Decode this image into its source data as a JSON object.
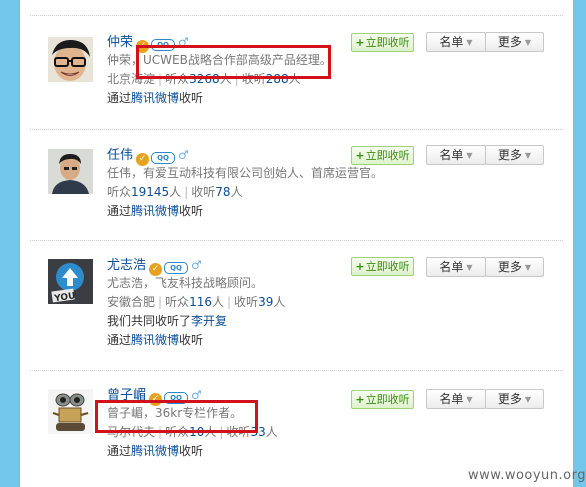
{
  "buttons": {
    "follow": "立即收听",
    "list": "名单",
    "more": "更多"
  },
  "icons": {
    "verified": "verified-badge-icon",
    "qq": "qq-icon",
    "gender": "male-icon"
  },
  "users": [
    {
      "name": "仲荣",
      "bio": "仲荣，UCWEB战略合作部高级产品经理。",
      "location": "北京海淀",
      "listeners_label": "听众",
      "listeners": "3268",
      "following_label": "收听",
      "following": "288",
      "unit": "人",
      "via_prefix": "通过",
      "via_app": "腾讯微博",
      "via_suffix": "收听"
    },
    {
      "name": "任伟",
      "bio": "任伟，有爱互动科技有限公司创始人、首席运营官。",
      "location": "",
      "listeners_label": "听众",
      "listeners": "19145",
      "following_label": "收听",
      "following": "78",
      "unit": "人",
      "via_prefix": "通过",
      "via_app": "腾讯微博",
      "via_suffix": "收听"
    },
    {
      "name": "尤志浩",
      "bio": "尤志浩，飞友科技战略顾问。",
      "location": "安徽合肥",
      "listeners_label": "听众",
      "listeners": "116",
      "following_label": "收听",
      "following": "39",
      "unit": "人",
      "mutual_text": "我们共同收听了",
      "mutual_name": "李开复",
      "via_prefix": "通过",
      "via_app": "腾讯微博",
      "via_suffix": "收听"
    },
    {
      "name": "曾子嵋",
      "bio": "曾子嵋，36kr专栏作者。",
      "location": "马尔代夫",
      "listeners_label": "听众",
      "listeners": "10",
      "following_label": "收听",
      "following": "33",
      "unit": "人",
      "via_prefix": "通过",
      "via_app": "腾讯微博",
      "via_suffix": "收听"
    }
  ],
  "watermark": "www.wooyun.org",
  "colors": {
    "sidebar": "#71c6ea",
    "link": "#0a4d96",
    "follow_green": "#3d8b11",
    "highlight_red": "#d3111b"
  }
}
